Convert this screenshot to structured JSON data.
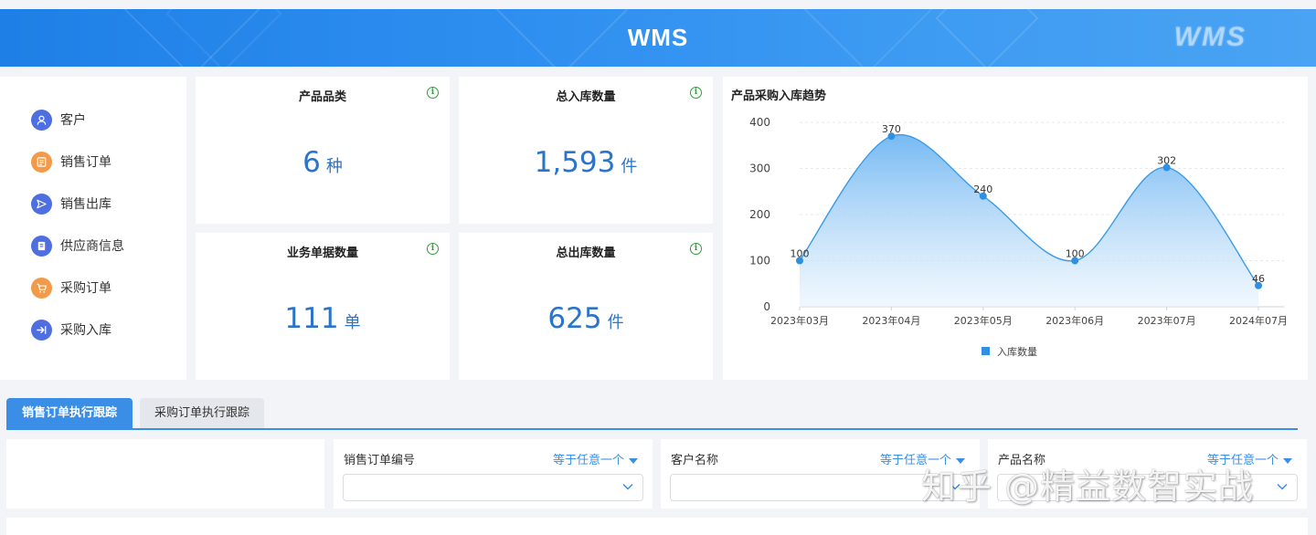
{
  "header": {
    "title": "WMS",
    "logo_text": "WMS"
  },
  "nav": {
    "items": [
      {
        "label": "客户",
        "icon": "customer-icon",
        "color": "#4f6fe0"
      },
      {
        "label": "销售订单",
        "icon": "sales-order-icon",
        "color": "#f29a4a"
      },
      {
        "label": "销售出库",
        "icon": "sales-outbound-icon",
        "color": "#4f6fe0"
      },
      {
        "label": "供应商信息",
        "icon": "supplier-icon",
        "color": "#4f6fe0"
      },
      {
        "label": "采购订单",
        "icon": "purchase-order-icon",
        "color": "#f29a4a"
      },
      {
        "label": "采购入库",
        "icon": "purchase-inbound-icon",
        "color": "#4f6fe0"
      }
    ]
  },
  "stats": [
    {
      "title": "产品品类",
      "value": "6",
      "unit": "种"
    },
    {
      "title": "总入库数量",
      "value": "1,593",
      "unit": "件"
    },
    {
      "title": "业务单据数量",
      "value": "111",
      "unit": "单"
    },
    {
      "title": "总出库数量",
      "value": "625",
      "unit": "件"
    }
  ],
  "chart_data": {
    "type": "area",
    "title": "产品采购入库趋势",
    "categories": [
      "2023年03月",
      "2023年04月",
      "2023年05月",
      "2023年06月",
      "2023年07月",
      "2024年07月"
    ],
    "series": [
      {
        "name": "入库数量",
        "values": [
          100,
          370,
          240,
          100,
          302,
          46
        ]
      }
    ],
    "yticks": [
      0,
      100,
      200,
      300,
      400
    ],
    "ylim": [
      0,
      400
    ],
    "grid": true,
    "legend": "bottom",
    "line_color": "#3a9be8"
  },
  "tabs": [
    {
      "label": "销售订单执行跟踪",
      "active": true
    },
    {
      "label": "采购订单执行跟踪",
      "active": false
    }
  ],
  "filters": [
    {
      "label": "销售订单编号",
      "operator": "等于任意一个"
    },
    {
      "label": "客户名称",
      "operator": "等于任意一个"
    },
    {
      "label": "产品名称",
      "operator": "等于任意一个"
    }
  ],
  "watermark": "知乎 @精益数智实战",
  "colors": {
    "primary": "#3a8ee6",
    "accent_value": "#2a74c9",
    "info_green": "#2ea23a"
  }
}
